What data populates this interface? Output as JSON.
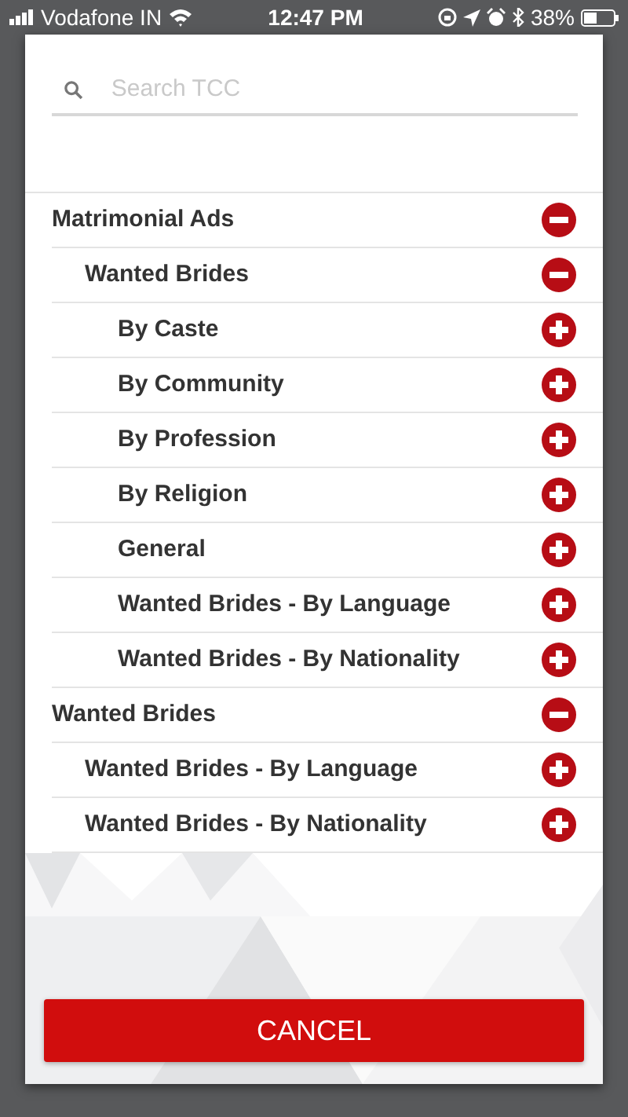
{
  "status_bar": {
    "carrier": "Vodafone IN",
    "time": "12:47 PM",
    "battery": "38%"
  },
  "search": {
    "placeholder": "Search TCC"
  },
  "tree": [
    {
      "label": "Matrimonial Ads",
      "expanded": true,
      "children": [
        {
          "label": "Wanted Brides",
          "expanded": true,
          "children": [
            {
              "label": "By Caste",
              "expanded": false
            },
            {
              "label": "By Community",
              "expanded": false
            },
            {
              "label": "By Profession",
              "expanded": false
            },
            {
              "label": "By Religion",
              "expanded": false
            },
            {
              "label": "General",
              "expanded": false
            },
            {
              "label": "Wanted Brides - By Language",
              "expanded": false
            },
            {
              "label": "Wanted Brides - By Nationality",
              "expanded": false
            }
          ]
        }
      ]
    },
    {
      "label": "Wanted Brides",
      "expanded": true,
      "children": [
        {
          "label": "Wanted Brides - By Language",
          "expanded": false
        },
        {
          "label": "Wanted Brides - By Nationality",
          "expanded": false
        }
      ]
    }
  ],
  "buttons": [
    "CANCEL"
  ]
}
